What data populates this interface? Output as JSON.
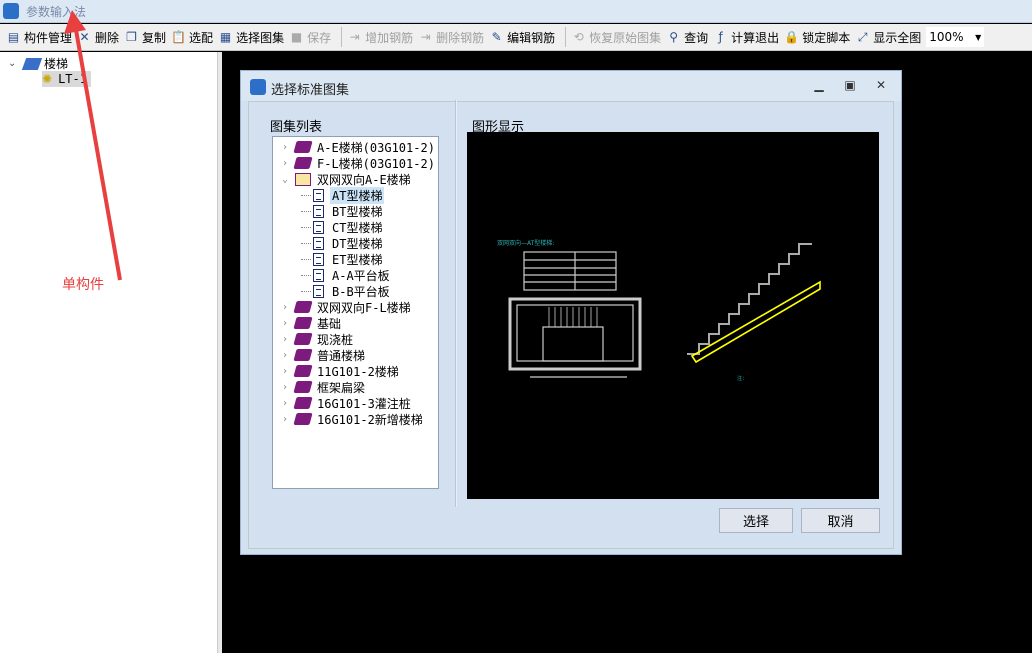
{
  "app": {
    "title": "参数输入法"
  },
  "toolbar": {
    "items": [
      {
        "label": "构件管理",
        "icon": "component-manager-icon",
        "enabled": true
      },
      {
        "label": "删除",
        "icon": "delete-x-icon",
        "enabled": true
      },
      {
        "label": "复制",
        "icon": "copy-icon",
        "enabled": true
      },
      {
        "label": "选配",
        "icon": "paste-icon",
        "enabled": true
      },
      {
        "label": "选择图集",
        "icon": "atlas-icon",
        "enabled": true
      },
      {
        "label": "保存",
        "icon": "save-icon",
        "enabled": false
      },
      {
        "label": "增加钢筋",
        "icon": "add-rebar-icon",
        "enabled": false
      },
      {
        "label": "删除钢筋",
        "icon": "remove-rebar-icon",
        "enabled": false
      },
      {
        "label": "编辑钢筋",
        "icon": "edit-rebar-icon",
        "enabled": true
      },
      {
        "label": "恢复原始图集",
        "icon": "restore-icon",
        "enabled": false
      },
      {
        "label": "查询",
        "icon": "binoculars-icon",
        "enabled": true
      },
      {
        "label": "计算退出",
        "icon": "function-icon",
        "enabled": true
      },
      {
        "label": "锁定脚本",
        "icon": "lock-icon",
        "enabled": true
      },
      {
        "label": "显示全图",
        "icon": "fit-all-icon",
        "enabled": true
      }
    ],
    "zoom": "100%"
  },
  "left_tree": {
    "root": "楼梯",
    "child": "LT-1"
  },
  "annotation": {
    "label": "单构件",
    "color": "#e84040"
  },
  "dialog": {
    "title": "选择标准图集",
    "list_label": "图集列表",
    "preview_label": "图形显示",
    "tree": [
      {
        "label": "A-E楼梯(03G101-2)",
        "type": "book",
        "level": 0,
        "expanded": false
      },
      {
        "label": "F-L楼梯(03G101-2)",
        "type": "book",
        "level": 0,
        "expanded": false
      },
      {
        "label": "双网双向A-E楼梯",
        "type": "openbook",
        "level": 0,
        "expanded": true
      },
      {
        "label": "AT型楼梯",
        "type": "doc",
        "level": 1,
        "selected": true
      },
      {
        "label": "BT型楼梯",
        "type": "doc",
        "level": 1
      },
      {
        "label": "CT型楼梯",
        "type": "doc",
        "level": 1
      },
      {
        "label": "DT型楼梯",
        "type": "doc",
        "level": 1
      },
      {
        "label": "ET型楼梯",
        "type": "doc",
        "level": 1
      },
      {
        "label": "A-A平台板",
        "type": "doc",
        "level": 1
      },
      {
        "label": "B-B平台板",
        "type": "doc",
        "level": 1
      },
      {
        "label": "双网双向F-L楼梯",
        "type": "book",
        "level": 0
      },
      {
        "label": "基础",
        "type": "book",
        "level": 0
      },
      {
        "label": "现浇桩",
        "type": "book",
        "level": 0
      },
      {
        "label": "普通楼梯",
        "type": "book",
        "level": 0
      },
      {
        "label": "11G101-2楼梯",
        "type": "book",
        "level": 0
      },
      {
        "label": "框架扁梁",
        "type": "book",
        "level": 0
      },
      {
        "label": "16G101-3灌注桩",
        "type": "book",
        "level": 0
      },
      {
        "label": "16G101-2新增楼梯",
        "type": "book",
        "level": 0
      }
    ],
    "select_button": "选择",
    "cancel_button": "取消",
    "preview_title": "双网双向—AT型楼梯:"
  }
}
